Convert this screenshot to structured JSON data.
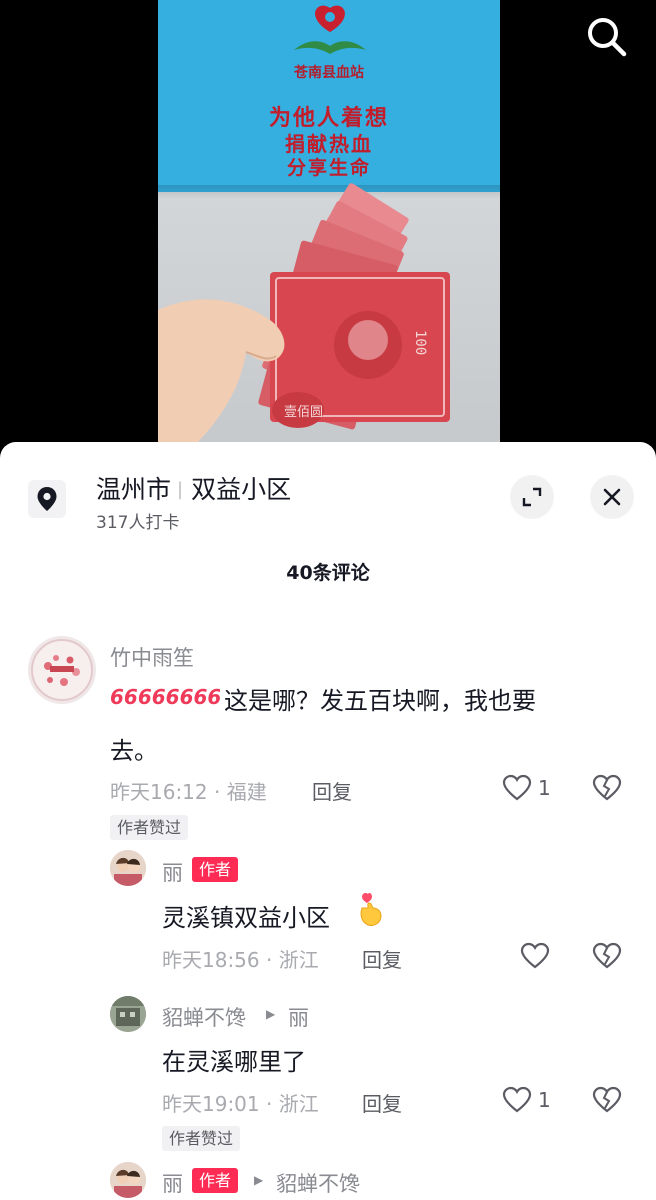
{
  "video": {
    "bag_org": "苍南县血站",
    "bag_lines": [
      "为他人着想",
      "捐献热血",
      "分享生命"
    ],
    "banknote_text": "壹佰圆"
  },
  "location": {
    "city": "温州市",
    "place": "双益小区",
    "checkins": "317人打卡"
  },
  "comments_header": "40条评论",
  "comments": [
    {
      "user": "竹中雨笙",
      "emoji_text": "666666666",
      "text_line1": "这是哪？发五百块啊，我也要",
      "text_line2": "去。",
      "meta": "昨天16:12 · 福建",
      "reply_label": "回复",
      "likes": "1",
      "chip": "作者赞过"
    },
    {
      "user": "丽",
      "badge": "作者",
      "text": "灵溪镇双益小区",
      "meta": "昨天18:56 · 浙江",
      "reply_label": "回复"
    },
    {
      "user": "貂蝉不馋",
      "reply_to": "丽",
      "text": "在灵溪哪里了",
      "meta": "昨天19:01 · 浙江",
      "reply_label": "回复",
      "likes": "1",
      "chip": "作者赞过"
    },
    {
      "user": "丽",
      "badge": "作者",
      "reply_to": "貂蝉不馋"
    }
  ],
  "colors": {
    "accent": "#fe2c55",
    "bag": "#35aee0",
    "banknote": "#d8474f"
  },
  "icons": [
    "search-icon",
    "location-pin-icon",
    "expand-icon",
    "close-icon",
    "heart-icon",
    "broken-heart-icon",
    "finger-heart-emoji"
  ]
}
